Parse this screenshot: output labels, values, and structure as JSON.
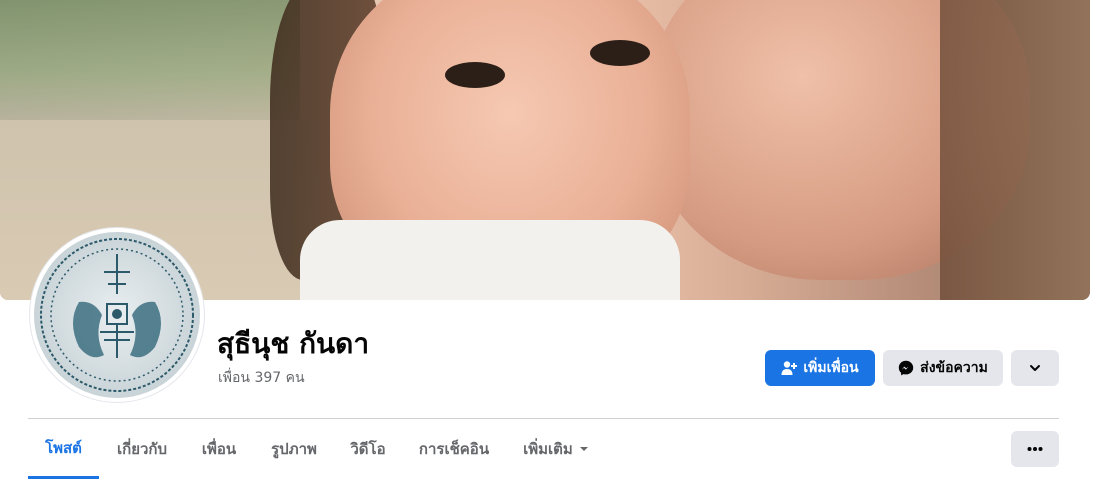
{
  "profile": {
    "name": "สุธีนุช กันดา",
    "friends_text": "เพื่อน 397 คน"
  },
  "actions": {
    "add_friend_label": "เพิ่มเพื่อน",
    "message_label": "ส่งข้อความ"
  },
  "tabs": [
    {
      "label": "โพสต์",
      "active": true
    },
    {
      "label": "เกี่ยวกับ",
      "active": false
    },
    {
      "label": "เพื่อน",
      "active": false
    },
    {
      "label": "รูปภาพ",
      "active": false
    },
    {
      "label": "วิดีโอ",
      "active": false
    },
    {
      "label": "การเช็คอิน",
      "active": false
    },
    {
      "label": "เพิ่มเติม",
      "active": false
    }
  ],
  "colors": {
    "accent": "#1b74e4",
    "secondary_button": "#e4e6eb",
    "text_primary": "#050505",
    "text_secondary": "#65676b"
  },
  "icons": {
    "add_friend": "person-plus-icon",
    "message": "messenger-icon",
    "more_actions": "chevron-down-icon",
    "more_tab": "caret-down-icon",
    "tab_options": "ellipsis-icon"
  }
}
